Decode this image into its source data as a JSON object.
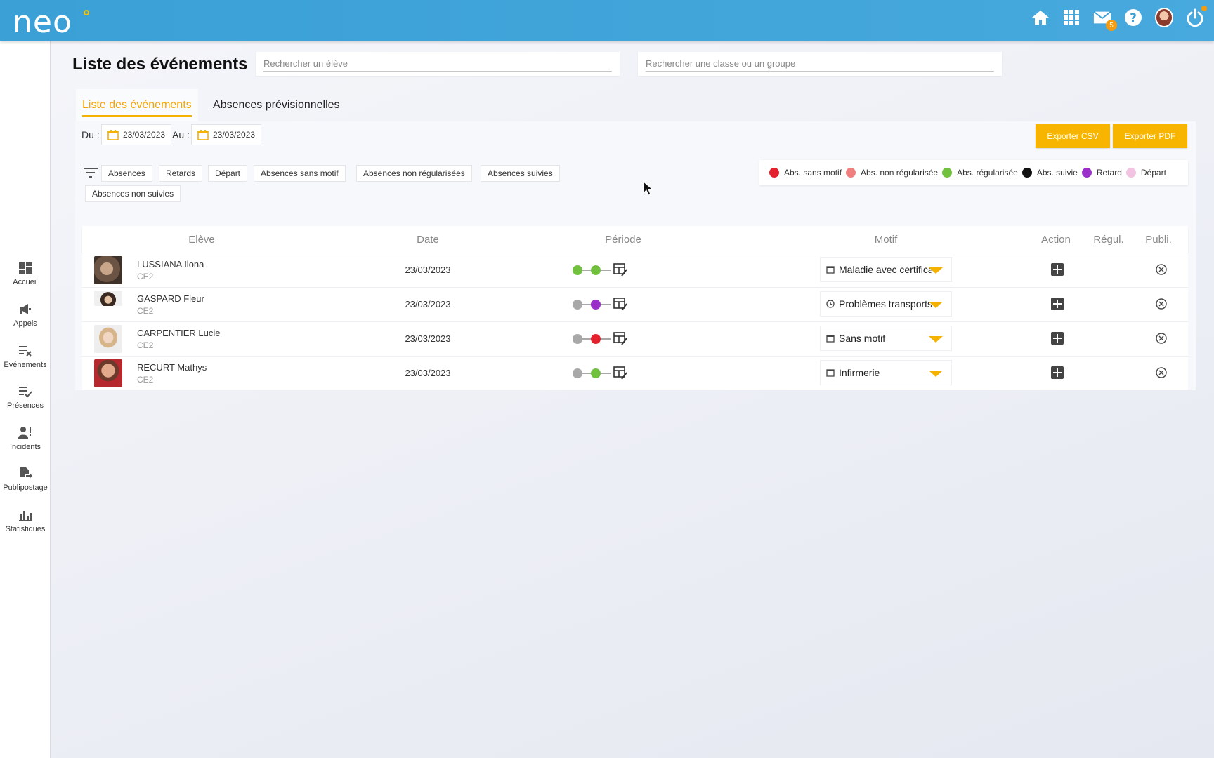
{
  "app": {
    "logo": "neo",
    "mail_badge": "5"
  },
  "topbar": {
    "icons": [
      "home-icon",
      "apps-grid-icon",
      "mail-icon",
      "help-icon",
      "user-avatar",
      "power-icon"
    ]
  },
  "sidebar": {
    "items": [
      {
        "label": "Accueil",
        "icon": "dashboard-icon"
      },
      {
        "label": "Appels",
        "icon": "megaphone-icon"
      },
      {
        "label": "Evénements",
        "icon": "list-remove-icon"
      },
      {
        "label": "Présences",
        "icon": "list-check-icon"
      },
      {
        "label": "Incidents",
        "icon": "person-alert-icon"
      },
      {
        "label": "Publipostage",
        "icon": "document-send-icon"
      },
      {
        "label": "Statistiques",
        "icon": "bar-chart-icon"
      }
    ]
  },
  "header": {
    "title": "Liste des événements",
    "search_student_placeholder": "Rechercher un élève",
    "search_class_placeholder": "Rechercher une classe ou un groupe"
  },
  "tabs": [
    {
      "label": "Liste des événements",
      "active": true
    },
    {
      "label": "Absences prévisionnelles",
      "active": false
    }
  ],
  "dates": {
    "from_label": "Du :",
    "from": "23/03/2023",
    "to_label": "Au :",
    "to": "23/03/2023"
  },
  "exports": {
    "csv": "Exporter CSV",
    "pdf": "Exporter PDF"
  },
  "filters": [
    "Absences",
    "Retards",
    "Départ",
    "Absences sans motif",
    "Absences non régularisées",
    "Absences suivies",
    "Absences non suivies"
  ],
  "legend": [
    {
      "label": "Abs. sans motif",
      "color": "#e5202e"
    },
    {
      "label": "Abs. non régularisée",
      "color": "#f08080"
    },
    {
      "label": "Abs. régularisée",
      "color": "#72c13e"
    },
    {
      "label": "Abs. suivie",
      "color": "#111111"
    },
    {
      "label": "Retard",
      "color": "#9b2fc9"
    },
    {
      "label": "Départ",
      "color": "#f2c4e2"
    }
  ],
  "table": {
    "headers": {
      "student": "Elève",
      "date": "Date",
      "period": "Période",
      "motif": "Motif",
      "action": "Action",
      "regul": "Régul.",
      "publi": "Publi."
    },
    "rows": [
      {
        "name": "LUSSIANA Ilona",
        "class": "CE2",
        "date": "23/03/2023",
        "period": [
          "#72c13e",
          "#72c13e"
        ],
        "motif": "Maladie avec certificat",
        "motif_icon": "calendar-icon"
      },
      {
        "name": "GASPARD Fleur",
        "class": "CE2",
        "date": "23/03/2023",
        "period": [
          "#a8a8a8",
          "#9b2fc9"
        ],
        "motif": "Problèmes transports",
        "motif_icon": "clock-icon"
      },
      {
        "name": "CARPENTIER Lucie",
        "class": "CE2",
        "date": "23/03/2023",
        "period": [
          "#a8a8a8",
          "#e5202e"
        ],
        "motif": "Sans motif",
        "motif_icon": "calendar-icon"
      },
      {
        "name": "RECURT Mathys",
        "class": "CE2",
        "date": "23/03/2023",
        "period": [
          "#a8a8a8",
          "#72c13e"
        ],
        "motif": "Infirmerie",
        "motif_icon": "calendar-icon"
      }
    ]
  },
  "colors": {
    "accent": "#f5b100",
    "topbar": "#3aa0d6"
  }
}
